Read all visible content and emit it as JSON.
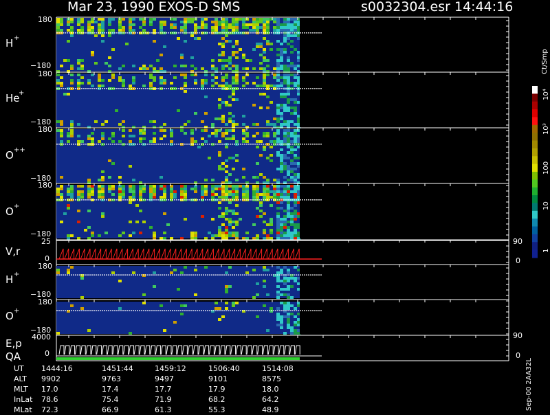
{
  "header": {
    "title": "Mar 23, 1990    EXOS-D SMS",
    "file": "s0032304.esr  14:44:16"
  },
  "panels": [
    {
      "label": "H",
      "sup": "+",
      "ytop": "180",
      "ybottom": "−180"
    },
    {
      "label": "He",
      "sup": "+",
      "ytop": "180",
      "ybottom": "−180"
    },
    {
      "label": "O",
      "sup": "++",
      "ytop": "180",
      "ybottom": "−180"
    },
    {
      "label": "O",
      "sup": "+",
      "ytop": "180",
      "ybottom": "−180"
    },
    {
      "label": "H",
      "sup": "+",
      "ytop": "180",
      "ybottom": "−180"
    },
    {
      "label": "O",
      "sup": "+",
      "ytop": "180",
      "ybottom": "−180"
    }
  ],
  "vr_panel": {
    "label": "V,r",
    "left_top": "25",
    "left_bottom": "0",
    "right_top": "90",
    "right_bottom": "0"
  },
  "ep_panel": {
    "label1": "E,p",
    "label2": "QA",
    "left_top": "4000",
    "left_bottom": "0",
    "right_top": "90",
    "right_bottom": "0"
  },
  "colorbar": {
    "unit": "Ct/Smp",
    "labels": [
      "10⁴",
      "10³",
      "100",
      "10",
      "1"
    ],
    "colors": [
      "#ffffff",
      "#7a0000",
      "#aa0000",
      "#dd0000",
      "#ff1010",
      "#a06800",
      "#907000",
      "#a08800",
      "#b0a000",
      "#c8c000",
      "#e0e000",
      "#80c000",
      "#50c820",
      "#20b030",
      "#008a40",
      "#007a70",
      "#30c8c8",
      "#108ab0",
      "#0060a0",
      "#1040a0",
      "#102080",
      "#102090"
    ]
  },
  "ephemeris": {
    "rows": [
      {
        "label": "UT",
        "values": [
          "1444:16",
          "1451:44",
          "1459:12",
          "1506:40",
          "1514:08"
        ]
      },
      {
        "label": "ALT",
        "values": [
          "9902",
          "9763",
          "9497",
          "9101",
          "8575"
        ]
      },
      {
        "label": "MLT",
        "values": [
          "17.0",
          "17.4",
          "17.7",
          "17.9",
          "18.0"
        ]
      },
      {
        "label": "InLat",
        "values": [
          "78.6",
          "75.4",
          "71.9",
          "68.2",
          "64.2"
        ]
      },
      {
        "label": "MLat",
        "values": [
          "72.3",
          "66.9",
          "61.3",
          "55.3",
          "48.9"
        ]
      }
    ]
  },
  "side_label": "Sep-00  2AA32L",
  "chart_data": {
    "type": "heatmap",
    "x_axis": "UT",
    "x_ticks": [
      "1444:16",
      "1451:44",
      "1459:12",
      "1506:40",
      "1514:08"
    ],
    "y_range_pitch_angle": [
      -180,
      180
    ],
    "color_scale": "log",
    "color_range": [
      1,
      10000
    ],
    "color_unit": "Ct/Smp",
    "series": [
      {
        "name": "H+"
      },
      {
        "name": "He+"
      },
      {
        "name": "O++"
      },
      {
        "name": "O+"
      },
      {
        "name": "H+"
      },
      {
        "name": "O+"
      }
    ]
  }
}
